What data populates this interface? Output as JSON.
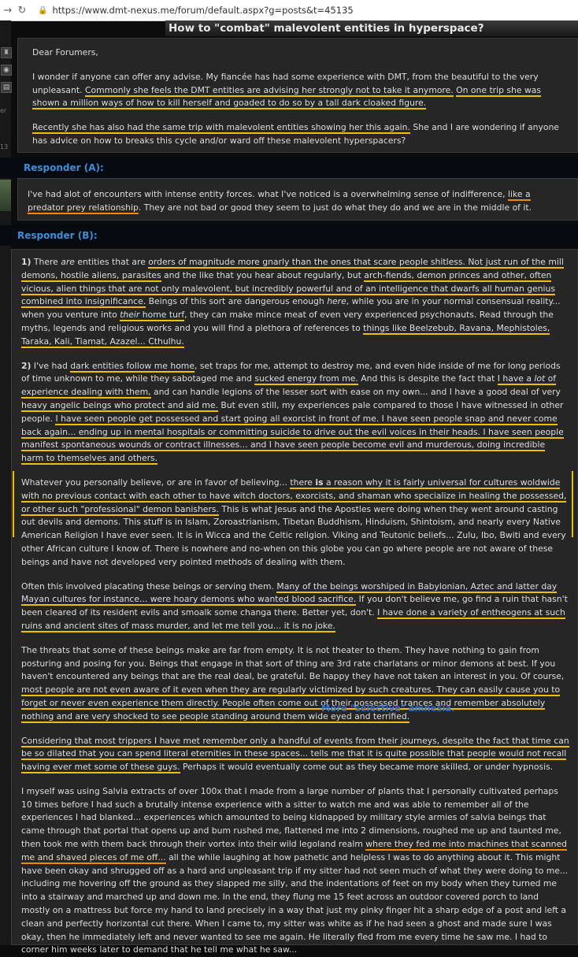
{
  "browser": {
    "url": "https://www.dmt-nexus.me/forum/default.aspx?g=posts&t=45135"
  },
  "thread": {
    "title": "How to \"combat\" malevolent entities in hyperspace?"
  },
  "sidebar": {
    "label_a": "er",
    "label_b": "13"
  },
  "op": {
    "greeting": "Dear Forumers,",
    "p1_a": "I wonder if anyone can offer any advise. My fiancée has had some experience with DMT, from the beautiful to the very unpleasant. ",
    "p1_h1": "Commonly she feels the DMT entities are advising her strongly not to take it anymore.",
    "p1_b": " ",
    "p1_h2": "On one trip she was shown a million ways of how to kill herself and goaded to do so by a tall dark cloaked figure.",
    "p2_h": "Recently she has also had the same trip with malevolent entities showing her this again.",
    "p2_b": " She and I are wondering if anyone has advice on how to breaks this cycle and/or ward off these malevolent hyperspacers?"
  },
  "responder_a": {
    "label": "Responder (A):",
    "text_a": "I've had alot of encounters with intense entity forces. what I've noticed is a overwhelming sense of indifference, ",
    "text_h": "like a predator prey relationship",
    "text_b": ". They are not bad or good they seem to just do what they do and we are in the middle of it."
  },
  "responder_b": {
    "label": "Responder (B):",
    "b1_num": "1)",
    "b1_a": " There ",
    "b1_are": "are",
    "b1_b": " entities that are ",
    "b1_h1": "orders of magnitude more gnarly than the ones that scare people shitless. Not just run of the mill demons, hostile aliens, parasites",
    "b1_c": " and the like that you hear about regularly, but ",
    "b1_h2": "arch-fiends, demon princes and other, often vicious, alien things that are not only malevolent, but incredibly powerful and of an intelligence that dwarfs all human genius combined into insignificance.",
    "b1_d": " Beings of this sort are dangerous enough ",
    "b1_here": "here",
    "b1_e": ", while you are in your normal consensual reality... when you venture into ",
    "b1_their": "their",
    "b1_f": " home turf",
    "b1_g": ", they can make mince meat of even very experienced psychonauts. Read through the myths, legends and religious works and you will find a plethora of references to ",
    "b1_h3": "things like Beelzebub, Ravana, Mephistoles, Taraka, Kali, Tiamat, Azazel... Cthulhu.",
    "b2_num": "2)",
    "b2_a": " I've had ",
    "b2_h1": "dark entities follow me home",
    "b2_b": ", set traps for me, attempt to destroy me, and even hide inside of me for long periods of time unknown to me, while they sabotaged me and ",
    "b2_h2": "sucked energy from me.",
    "b2_c": " And this is despite the fact that ",
    "b2_h3a": "I have a ",
    "b2_lot": "lot",
    "b2_h3b": " of experience dealing with them,",
    "b2_d": " and can handle legions of the lesser sort with ease on my own... and I have a good deal of very ",
    "b2_h4": "heavy angelic beings who protect and aid me.",
    "b2_e": " But even still, my experiences pale compared to those I have witnessed in other people. ",
    "b2_h5": "I have seen people get possessed and start going all exorcist in front of me. I have seen people snap and never come back again... ending up in mental hospitals or committing suicide to drive out the evil voices in their heads. I have seen people manifest spontaneous wounds or contract illnesses... and I have seen people become evil and murderous, doing incredible harm to themselves and others.",
    "b3_a": "Whatever you personally believe, or are in favor of believing... ",
    "b3_h1a": "there ",
    "b3_is": "is",
    "b3_h1b": " a reason why it is fairly universal for cultures woldwide with no previous contact with each other to have witch doctors, exorcists, and shaman who specialize in healing the possessed, or other such \"professional\" demon banishers.",
    "b3_b": " This is what Jesus and the Apostles were doing when they went around casting out devils and demons. This stuff is in Islam, Zoroastrianism, Tibetan Buddhism, Hinduism, Shintoism, and nearly every Native American Religion I have ever seen. It is in Wicca and the Celtic religion. Viking and Teutonic beliefs... Zulu, Ibo, Bwiti and every other African culture I know of. There is nowhere and no-when on this globe you can go where people are not aware of these beings and have not developed very pointed methods of dealing with them.",
    "b4_a": "Often this involved placating these beings or serving them. ",
    "b4_h1": "Many of the beings worshiped in Babylonian, Aztec and latter day Mayan cultures for instance... were hoary demons who wanted blood sacrifice.",
    "b4_b": " If you don't believe me, go find a ruin that hasn't been cleared of its resident evils and smoalk some changa there. Better yet, don't. ",
    "b4_h2": "I have done a variety of entheogens at such ruins and ancient sites of mass murder, and let me tell you... it is no joke.",
    "b5_a": "The threats that some of these beings make are far from empty. It is not theater to them. They have nothing to gain from posturing and posing for you. Beings that engage in that sort of thing are 3rd rate charlatans or minor demons at best. If you haven't encountered any beings that are the real deal, be grateful. Be happy they have not taken an interest in you. Of course, ",
    "b5_h1": "most people are not even aware of it even when they are regularly victimized by such creatures. They can easily cause you to forget or never even experience them directly. People often come out of their possessed trances and remember absolutely nothing and are very shocked to see people standing around them wide eyed and terrified.",
    "annotation": "More \"selective\" amnesia.",
    "b6_h1": "Considering that most trippers I have met remember only a handful of events from their journeys, despite the fact that time can be so dilated that you can spend literal eternities in these spaces... tells me that it is quite possible that people would not recall having ever met some of these guys.",
    "b6_b": " Perhaps it would eventually come out as they became more skilled, or under hypnosis.",
    "b7_a": "I myself was using Salvia extracts of over 100x that I made from a large number of plants that I personally cultivated perhaps 10 times before I had such a brutally intense experience with a sitter to watch me and was able to remember all of the experiences I had blanked... experiences which amounted to being kidnapped by military style armies of salvia beings that came through that portal that opens up and bum rushed me, flattened me into 2 dimensions, roughed me up and taunted me, then took me with them back through their vortex into their wild legoland realm ",
    "b7_h1": "where they fed me into machines that scanned me and shaved pieces of me off...",
    "b7_b": " all the while laughing at how pathetic and helpless I was to do anything about it. This might have been okay and shrugged off as a hard and unpleasant trip if my sitter had not seen much of what they were doing to me... including me hovering off the ground as they slapped me silly, and the indentations of feet on my body when they turned me into a stairway and marched up and down me. In the end, they flung me 15 feet across an outdoor covered porch to land mostly on a mattress but force my hand to land precisely in a way that just my pinky finger hit a sharp edge of a post and left a clean and perfectly horizontal cut there. When I came to, my sitter was white as if he had seen a ghost and made sure I was okay, then he immediately left and never wanted to see me again. He literally fled from me every time he saw me. I had to corner him weeks later to demand that he tell me what he saw..."
  }
}
